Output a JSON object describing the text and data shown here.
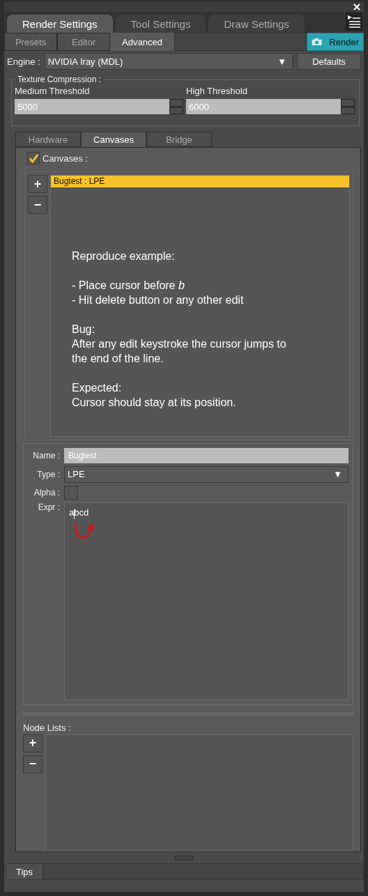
{
  "main_tabs": [
    {
      "label": "Render Settings",
      "selected": true
    },
    {
      "label": "Tool Settings",
      "selected": false
    },
    {
      "label": "Draw Settings",
      "selected": false
    }
  ],
  "sub_tabs": [
    {
      "label": "Presets",
      "selected": false
    },
    {
      "label": "Editor",
      "selected": false
    },
    {
      "label": "Advanced",
      "selected": true
    }
  ],
  "render_button": "Render",
  "engine": {
    "label": "Engine :",
    "value": "NVIDIA Iray (MDL)",
    "caret": "▼"
  },
  "defaults_button": "Defaults",
  "texture_compression": {
    "title": "Texture Compression :",
    "fields": [
      {
        "label": "Medium Threshold",
        "value": "5000"
      },
      {
        "label": "High Threshold",
        "value": "6000"
      }
    ]
  },
  "inner_tabs": [
    {
      "label": "Hardware",
      "selected": false
    },
    {
      "label": "Canvases",
      "selected": true
    },
    {
      "label": "Bridge",
      "selected": false
    }
  ],
  "canvases": {
    "label": "Canvases :",
    "checked": true,
    "add": "+",
    "remove": "−",
    "items": [
      {
        "label": "Bugtest : LPE",
        "selected": true
      }
    ],
    "note": [
      [
        "Reproduce example:"
      ],
      [
        "- Place cursor before *b*",
        "- Hit delete button or any other edit"
      ],
      [
        "Bug:",
        "After any edit keystroke the cursor jumps to",
        "the end of the line."
      ],
      [
        "Expected:",
        "Cursor should stay at its position."
      ]
    ]
  },
  "properties": {
    "name_label": "Name :",
    "name_value": "Bugtest",
    "type_label": "Type :",
    "type_value": "LPE",
    "type_caret": "▼",
    "alpha_label": "Alpha :",
    "alpha_checked": false,
    "expr_label": "Expr :",
    "expr_value": "abcd"
  },
  "node_lists": {
    "label": "Node Lists :",
    "add": "+",
    "remove": "−"
  },
  "status_tab": "Tips"
}
